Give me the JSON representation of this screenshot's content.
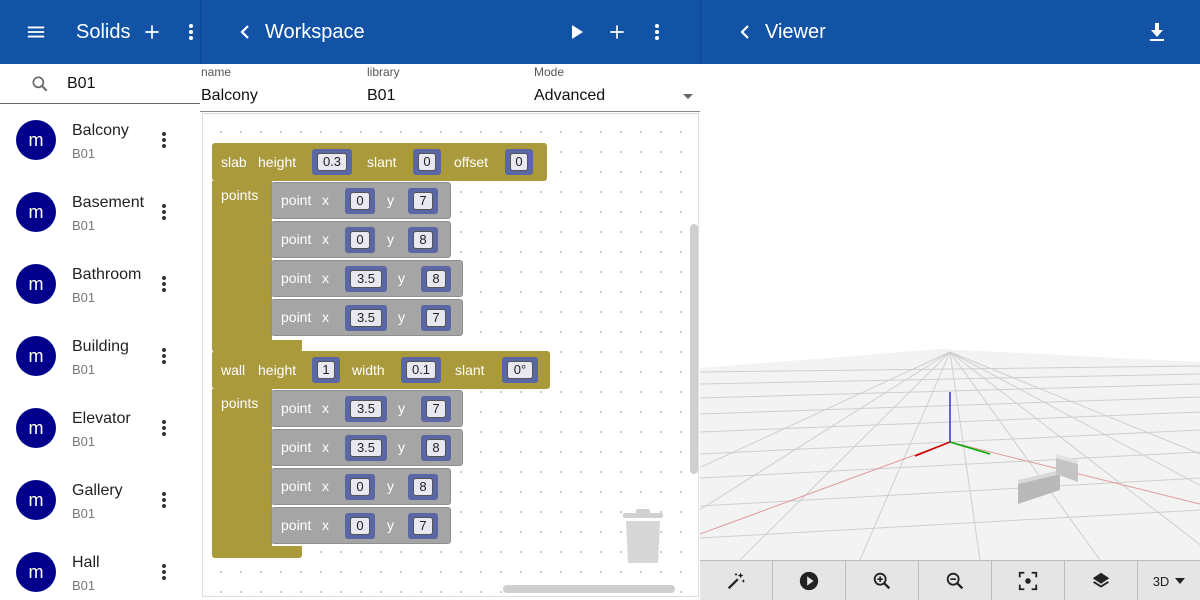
{
  "left_panel": {
    "title": "Solids",
    "search_value": "B01",
    "items": [
      {
        "avatar": "m",
        "title": "Balcony",
        "subtitle": "B01"
      },
      {
        "avatar": "m",
        "title": "Basement",
        "subtitle": "B01"
      },
      {
        "avatar": "m",
        "title": "Bathroom",
        "subtitle": "B01"
      },
      {
        "avatar": "m",
        "title": "Building",
        "subtitle": "B01"
      },
      {
        "avatar": "m",
        "title": "Elevator",
        "subtitle": "B01"
      },
      {
        "avatar": "m",
        "title": "Gallery",
        "subtitle": "B01"
      },
      {
        "avatar": "m",
        "title": "Hall",
        "subtitle": "B01"
      }
    ]
  },
  "workspace": {
    "title": "Workspace",
    "fields": {
      "name_label": "name",
      "name_value": "Balcony",
      "library_label": "library",
      "library_value": "B01",
      "mode_label": "Mode",
      "mode_value": "Advanced"
    },
    "slab": {
      "label": "slab",
      "height_label": "height",
      "height": "0.3",
      "slant_label": "slant",
      "slant": "0",
      "offset_label": "offset",
      "offset": "0",
      "points_label": "points",
      "points": [
        {
          "label": "point",
          "x_label": "x",
          "x": "0",
          "y_label": "y",
          "y": "7"
        },
        {
          "label": "point",
          "x_label": "x",
          "x": "0",
          "y_label": "y",
          "y": "8"
        },
        {
          "label": "point",
          "x_label": "x",
          "x": "3.5",
          "y_label": "y",
          "y": "8"
        },
        {
          "label": "point",
          "x_label": "x",
          "x": "3.5",
          "y_label": "y",
          "y": "7"
        }
      ]
    },
    "wall": {
      "label": "wall",
      "height_label": "height",
      "height": "1",
      "width_label": "width",
      "width": "0.1",
      "slant_label": "slant",
      "slant": "0°",
      "points_label": "points",
      "points": [
        {
          "label": "point",
          "x_label": "x",
          "x": "3.5",
          "y_label": "y",
          "y": "7"
        },
        {
          "label": "point",
          "x_label": "x",
          "x": "3.5",
          "y_label": "y",
          "y": "8"
        },
        {
          "label": "point",
          "x_label": "x",
          "x": "0",
          "y_label": "y",
          "y": "8"
        },
        {
          "label": "point",
          "x_label": "x",
          "x": "0",
          "y_label": "y",
          "y": "7"
        }
      ]
    }
  },
  "viewer": {
    "title": "Viewer",
    "view_mode": "3D",
    "toolbar_icons": [
      "magic-wand-icon",
      "play-circle-icon",
      "zoom-in-icon",
      "zoom-out-icon",
      "focus-icon",
      "layers-icon"
    ]
  },
  "colors": {
    "appbar": "#1253a6",
    "avatar": "#00008b",
    "block_olive": "#aa9a3b",
    "block_grey": "#a5a5a5",
    "number_block": "#5b67a5"
  }
}
